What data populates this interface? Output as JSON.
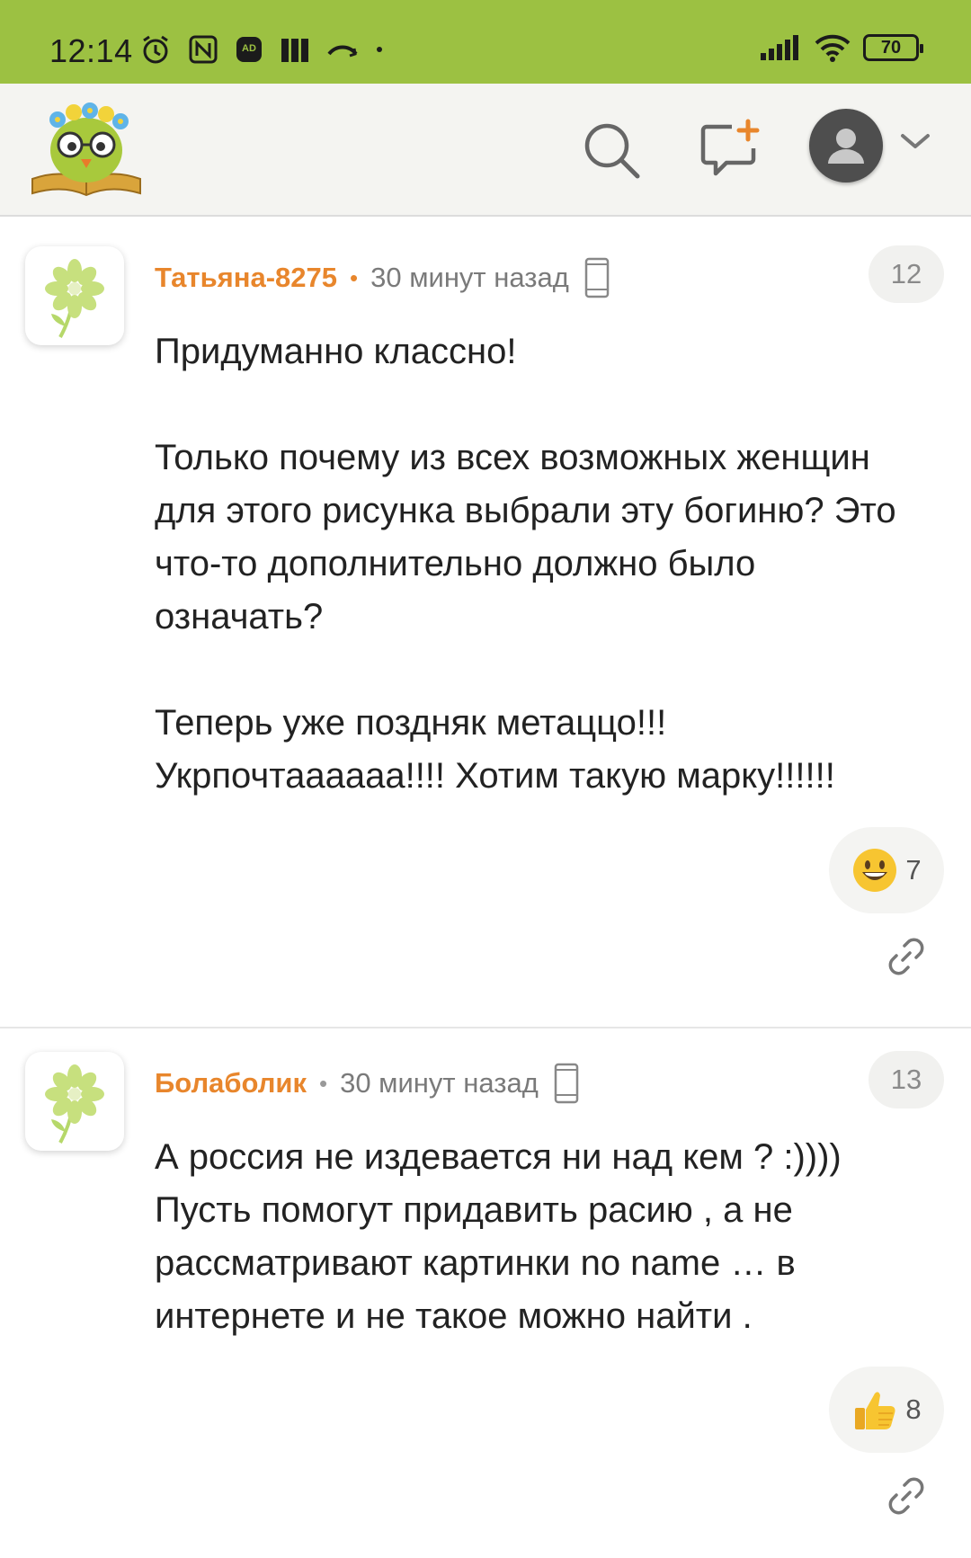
{
  "status_bar": {
    "time": "12:14",
    "battery": "70",
    "icons_left": [
      "alarm-icon",
      "nfc-icon",
      "adblocker-icon",
      "app-icon",
      "missed-call-icon",
      "dot-icon"
    ],
    "icons_right": [
      "signal-icon",
      "wifi-icon",
      "battery-icon"
    ]
  },
  "header": {
    "logo": "owl-book-logo",
    "buttons": [
      "search-icon",
      "new-comment-icon",
      "user-avatar-icon",
      "chevron-down-icon"
    ]
  },
  "comments": [
    {
      "author": "Татьяна-8275",
      "time": "30 минут назад",
      "number": "12",
      "paragraphs": [
        "Придуманно классно!",
        "",
        "Только почему из всех возможных женщин для этого рисунка выбрали эту богиню? Это что-то дополнительно должно было означать?",
        "",
        "Теперь уже поздняк метаццо!!! Укрпочтаааааа!!!! Хотим такую марку!!!!!!"
      ],
      "reaction": {
        "icon": "grinning-face-icon",
        "count": "7"
      }
    },
    {
      "author": "Болаболик",
      "time": "30 минут назад",
      "number": "13",
      "paragraphs": [
        "А россия не издевается ни над кем ? :)))) Пусть помогут придавить расию , а не рассматривают картинки no name … в интернете и не такое можно найти ."
      ],
      "reaction": {
        "icon": "thumbs-up-icon",
        "count": "8"
      }
    }
  ],
  "colors": {
    "status_bar": "#9cc142",
    "author": "#e8862c",
    "header_bg": "#f4f4f1"
  }
}
